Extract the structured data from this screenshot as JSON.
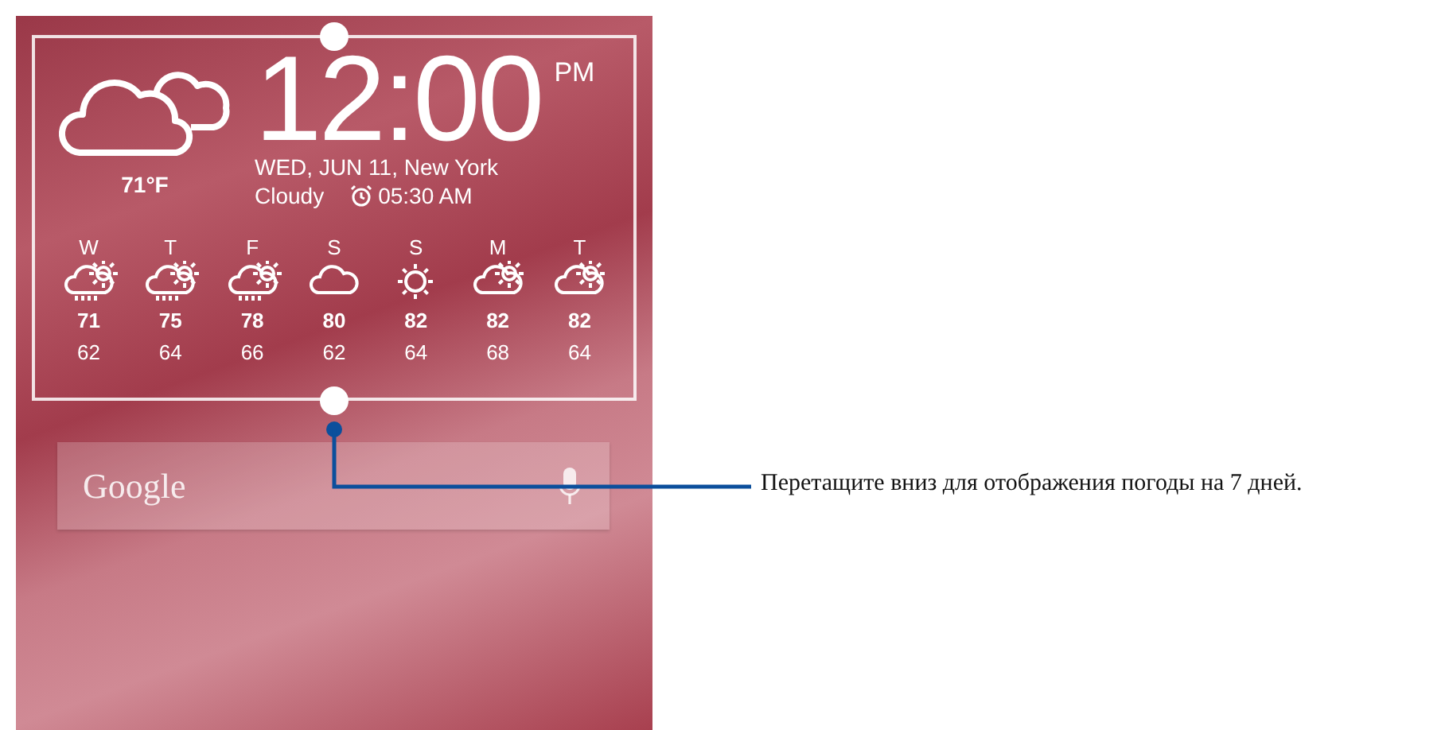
{
  "clock": {
    "time": "12:00",
    "ampm": "PM",
    "date": "WED, JUN 11, New York",
    "condition": "Cloudy",
    "alarm": "05:30 AM",
    "temperature": "71°F"
  },
  "forecast": [
    {
      "day": "W",
      "kind": "rain-sun",
      "high": "71",
      "low": "62"
    },
    {
      "day": "T",
      "kind": "rain-sun",
      "high": "75",
      "low": "64"
    },
    {
      "day": "F",
      "kind": "rain-sun",
      "high": "78",
      "low": "66"
    },
    {
      "day": "S",
      "kind": "cloud",
      "high": "80",
      "low": "62"
    },
    {
      "day": "S",
      "kind": "sun",
      "high": "82",
      "low": "64"
    },
    {
      "day": "M",
      "kind": "partly-cloudy",
      "high": "82",
      "low": "68"
    },
    {
      "day": "T",
      "kind": "partly-cloudy",
      "high": "82",
      "low": "64"
    }
  ],
  "search": {
    "logo": "Google"
  },
  "callout": "Перетащите вниз для отображения погоды на 7 дней."
}
